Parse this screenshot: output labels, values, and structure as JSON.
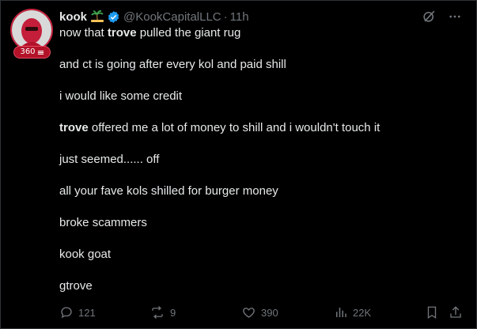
{
  "author": {
    "name": "kook",
    "handle": "@KookCapitalLLC",
    "time": "11h",
    "badge_count": "360",
    "emoji_icon": "island-icon",
    "verified_icon": "verified-badge-icon"
  },
  "tweet": {
    "lines": [
      {
        "pre": "now that ",
        "bold": "trove",
        "post": " pulled the giant rug"
      },
      {
        "pre": "and ct is going after every kol and paid shill",
        "bold": "",
        "post": ""
      },
      {
        "pre": "i would like some credit",
        "bold": "",
        "post": ""
      },
      {
        "pre": "",
        "bold": "trove",
        "post": " offered me a lot of money to shill and i wouldn't touch it"
      },
      {
        "pre": "just seemed...... off",
        "bold": "",
        "post": ""
      },
      {
        "pre": "all your fave kols shilled for burger money",
        "bold": "",
        "post": ""
      },
      {
        "pre": "broke scammers",
        "bold": "",
        "post": ""
      },
      {
        "pre": "kook goat",
        "bold": "",
        "post": ""
      },
      {
        "pre": "gtrove",
        "bold": "",
        "post": ""
      }
    ]
  },
  "stats": {
    "replies": "121",
    "reposts": "9",
    "likes": "390",
    "views": "22K"
  },
  "colors": {
    "background": "#000000",
    "text": "#e7e9ea",
    "muted": "#71767b",
    "verified": "#1d9bf0",
    "avatar_accent": "#c8243f"
  }
}
